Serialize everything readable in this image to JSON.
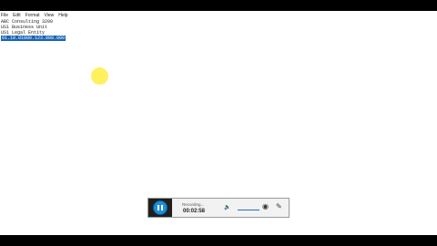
{
  "menu": {
    "items": [
      "File",
      "Edit",
      "Format",
      "View",
      "Help"
    ]
  },
  "document": {
    "lines": [
      "ABC Consulting 3200",
      "US1 Business Unit",
      "US1 Legal Entity"
    ],
    "selected_line": "01.10.01000.123.000.000"
  },
  "recorder": {
    "status": "Recording...",
    "time": "00:02:58",
    "icons": [
      "pause-icon",
      "volume-icon",
      "webcam-icon",
      "pen-icon"
    ],
    "colors": {
      "accent": "#1d8fd6",
      "panel": "#1f1f1f"
    }
  }
}
